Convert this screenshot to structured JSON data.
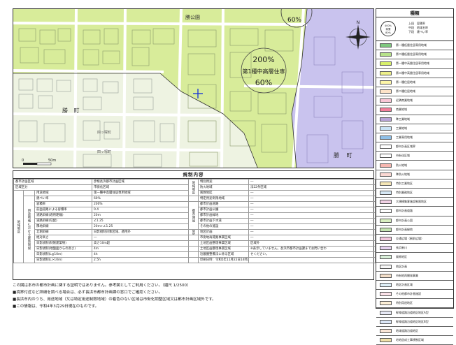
{
  "map": {
    "place_labels": [
      "勝公園",
      "勝 町",
      "四ッ塚町",
      "四ッ塚町",
      "勝 町"
    ],
    "stamp": {
      "ratio": "200%",
      "zone": "第1種中高層住専",
      "ratio2": "60%"
    },
    "partial_stamp": "60%",
    "scale_labels": [
      "0",
      "50m"
    ],
    "north_label": "N"
  },
  "legend": {
    "title": "種類",
    "key": {
      "circle_lines": [
        "容積率",
        "地域名",
        "建ぺい率"
      ],
      "circle_values": [
        "400%",
        "商業",
        "80%"
      ],
      "text_lines": [
        "上段　容積率",
        "中段　地域名称",
        "下段　建ぺい率"
      ]
    },
    "items": [
      {
        "label": "第一種低層住居専用地域",
        "color": "#7fc97f"
      },
      {
        "label": "第二種低層住居専用地域",
        "color": "#b7e28a"
      },
      {
        "label": "第一種中高層住居専用地域",
        "color": "#d8f06b"
      },
      {
        "label": "第二種中高層住居専用地域",
        "color": "#eef08a"
      },
      {
        "label": "第一種住居地域",
        "color": "#fdf6a8"
      },
      {
        "label": "第二種住居地域",
        "color": "#fde3c8"
      },
      {
        "label": "近隣商業地域",
        "color": "#f9c6d6"
      },
      {
        "label": "商業地域",
        "color": "#f37f9b"
      },
      {
        "label": "準工業地域",
        "color": "#b9a5d8"
      },
      {
        "label": "工業地域",
        "color": "#c9e3f6"
      },
      {
        "label": "工業専用地域",
        "color": "#8fc0e8"
      },
      {
        "label": "都市計画区域界",
        "color": "#ffffff"
      },
      {
        "label": "市街化区域",
        "color": "#ffffff"
      },
      {
        "label": "防火地域",
        "color": "#f6b7b0"
      },
      {
        "label": "準防火地域",
        "color": "#fbd8d3"
      },
      {
        "label": "特別工業地区",
        "color": "#f5e6b6"
      },
      {
        "label": "特別業務地区",
        "color": "#d6e8f5"
      },
      {
        "label": "大規模集客施設制限地区",
        "color": "#f2d2e6"
      },
      {
        "label": "都市計画道路",
        "color": "#ffffff"
      },
      {
        "label": "都市計画公園",
        "color": "#d9efc1"
      },
      {
        "label": "都市計画緑地",
        "color": "#c3e3b0"
      },
      {
        "label": "交通広場（駅前広場）",
        "color": "#f3c8dd"
      },
      {
        "label": "長浜新川",
        "color": "#e6d2f0"
      },
      {
        "label": "風致地区",
        "color": "#d9f0d9"
      },
      {
        "label": "地区計画",
        "color": "#f7f7f7"
      },
      {
        "label": "市街地再開発事業",
        "color": "#f4dfc9"
      },
      {
        "label": "地区計画区域",
        "color": "#e0f0f8"
      },
      {
        "label": "その他都市計画施設",
        "color": "#fce3ea"
      },
      {
        "label": "特別用途地区",
        "color": "#fdf0d7"
      },
      {
        "label": "幹線道路沿道地区地区A型",
        "color": "#e8eaf6"
      },
      {
        "label": "幹線道路沿道地区地区B型",
        "color": "#dde8f8"
      },
      {
        "label": "地域道路沿道地区",
        "color": "#fbe6d6"
      },
      {
        "label": "宅地造成工事規制区域",
        "color": "#f0e0a8"
      }
    ]
  },
  "regs": {
    "title": "規制内容",
    "group_zoning": "地域地区",
    "group_building": "用途地域における建築制限",
    "group_cityplan": "都市施設",
    "group_district": "地区計画",
    "rows": [
      [
        "都市計画区域",
        "彦根長浜都市計画区域",
        "特別用途",
        "―"
      ],
      [
        "区域区分",
        "市街化区域",
        "防火地域",
        "法22条区域"
      ],
      [
        "用途地域",
        "第一種中高層住居専用地域",
        "風致地区",
        "―"
      ],
      [
        "建ぺい率",
        "60%",
        "特定用途制限地域",
        "―"
      ],
      [
        "容積率",
        "200%",
        "都市計画道路",
        "―"
      ],
      [
        "前面道路による容積率",
        "0.4",
        "都市計画公園",
        "―"
      ],
      [
        "道路斜線(適用距離)",
        "20m",
        "都市計画緑地",
        "―"
      ],
      [
        "道路斜線(勾配)",
        "∠1.25",
        "都市計画下水道",
        "―"
      ],
      [
        "隣地斜線",
        "20m+∠1.25",
        "その他の施設",
        "―"
      ],
      [
        "北側斜線",
        "日影規制対象区域、適用外",
        "地区計画",
        "―"
      ],
      [
        "絶対高さ",
        "―",
        "市街地再開発事業区域",
        "―"
      ],
      [
        "日影規制(制限建築物)",
        "高さ10m超",
        "土地区画整理事業区域",
        "区域外"
      ],
      [
        "日影規制(地盤面からの高さ)",
        "4m",
        "土地区画整理事業区域",
        "※表示していません。長浜市都市計画課までお問い合わ"
      ],
      [
        "日影規制(L≦10m)",
        "4h",
        "近畿圏整備法に係る区域",
        "せください。"
      ],
      [
        "日影規制(L>10m)",
        "2.5h",
        "印刷日時：令和5年11月22日14時22分",
        ""
      ]
    ]
  },
  "notes": [
    "この図は本市の都市計画に関する証明ではありません。参考図としてご利用ください。（縮尺 1/2500）",
    "■境界付近など詳細を調べる場合は、必ず長浜市都市計画課の窓口でご確認ください。",
    "■長浜市内のうち、用途地域（又は特定用途制限地域）の着色のない区域は市街化調整区域又は都市計画区域外です。",
    "■この情報は、令和4年3月29日現在のものです。"
  ]
}
